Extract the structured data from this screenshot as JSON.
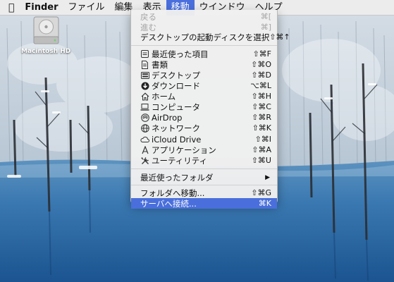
{
  "menubar": {
    "apple_icon": "apple-icon",
    "items": [
      {
        "label": "Finder",
        "bold": true
      },
      {
        "label": "ファイル"
      },
      {
        "label": "編集"
      },
      {
        "label": "表示"
      },
      {
        "label": "移動",
        "active": true
      },
      {
        "label": "ウインドウ"
      },
      {
        "label": "ヘルプ"
      }
    ]
  },
  "desktop": {
    "drive_label": "Macintosh HD",
    "drive_icon": "hard-drive-icon"
  },
  "go_menu": {
    "back": {
      "label": "戻る",
      "shortcut": "⌘[",
      "disabled": true
    },
    "forward": {
      "label": "進む",
      "shortcut": "⌘]",
      "disabled": true
    },
    "startup_disk": {
      "label": "デスクトップの起動ディスクを選択",
      "shortcut": "⇧⌘↑"
    },
    "recents": {
      "label": "最近使った項目",
      "shortcut": "⇧⌘F",
      "icon": "recents-icon"
    },
    "documents": {
      "label": "書類",
      "shortcut": "⇧⌘O",
      "icon": "documents-icon"
    },
    "desktop": {
      "label": "デスクトップ",
      "shortcut": "⇧⌘D",
      "icon": "desktop-icon"
    },
    "downloads": {
      "label": "ダウンロード",
      "shortcut": "⌥⌘L",
      "icon": "downloads-icon"
    },
    "home": {
      "label": "ホーム",
      "shortcut": "⇧⌘H",
      "icon": "home-icon"
    },
    "computer": {
      "label": "コンピュータ",
      "shortcut": "⇧⌘C",
      "icon": "computer-icon"
    },
    "airdrop": {
      "label": "AirDrop",
      "shortcut": "⇧⌘R",
      "icon": "airdrop-icon"
    },
    "network": {
      "label": "ネットワーク",
      "shortcut": "⇧⌘K",
      "icon": "network-icon"
    },
    "icloud": {
      "label": "iCloud Drive",
      "shortcut": "⇧⌘I",
      "icon": "cloud-icon"
    },
    "applications": {
      "label": "アプリケーション",
      "shortcut": "⇧⌘A",
      "icon": "applications-icon"
    },
    "utilities": {
      "label": "ユーティリティ",
      "shortcut": "⇧⌘U",
      "icon": "utilities-icon"
    },
    "recent_folders": {
      "label": "最近使ったフォルダ",
      "submenu_icon": "chevron-right-icon"
    },
    "go_to_folder": {
      "label": "フォルダへ移動...",
      "shortcut": "⇧⌘G"
    },
    "connect_server": {
      "label": "サーバへ接続...",
      "shortcut": "⌘K",
      "highlighted": true
    }
  }
}
